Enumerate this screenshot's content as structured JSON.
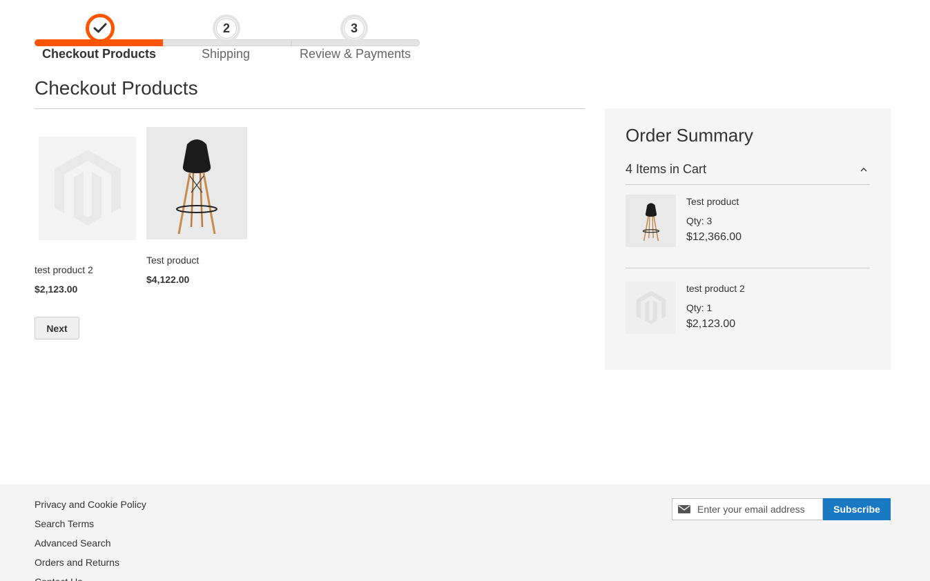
{
  "progress": {
    "steps": [
      {
        "number": "",
        "label": "Checkout Products",
        "state": "active"
      },
      {
        "number": "2",
        "label": "Shipping",
        "state": "pending"
      },
      {
        "number": "3",
        "label": "Review & Payments",
        "state": "pending"
      }
    ],
    "accent": "#ff5501"
  },
  "main": {
    "title": "Checkout Products",
    "products": [
      {
        "name": "test product 2",
        "price": "$2,123.00",
        "image": "placeholder-logo-icon"
      },
      {
        "name": "Test product",
        "price": "$4,122.00",
        "image": "chair-photo"
      }
    ],
    "next_label": "Next"
  },
  "summary": {
    "title": "Order Summary",
    "count": "4 Items in Cart",
    "items": [
      {
        "name": "Test product",
        "qty": "Qty: 3",
        "price": "$12,366.00",
        "image": "chair-photo"
      },
      {
        "name": "test product 2",
        "qty": "Qty: 1",
        "price": "$2,123.00",
        "image": "placeholder-logo-icon"
      }
    ]
  },
  "footer": {
    "links": [
      "Privacy and Cookie Policy",
      "Search Terms",
      "Advanced Search",
      "Orders and Returns",
      "Contact Us"
    ],
    "newsletter": {
      "placeholder": "Enter your email address",
      "button": "Subscribe",
      "button_color": "#1979c3"
    }
  }
}
